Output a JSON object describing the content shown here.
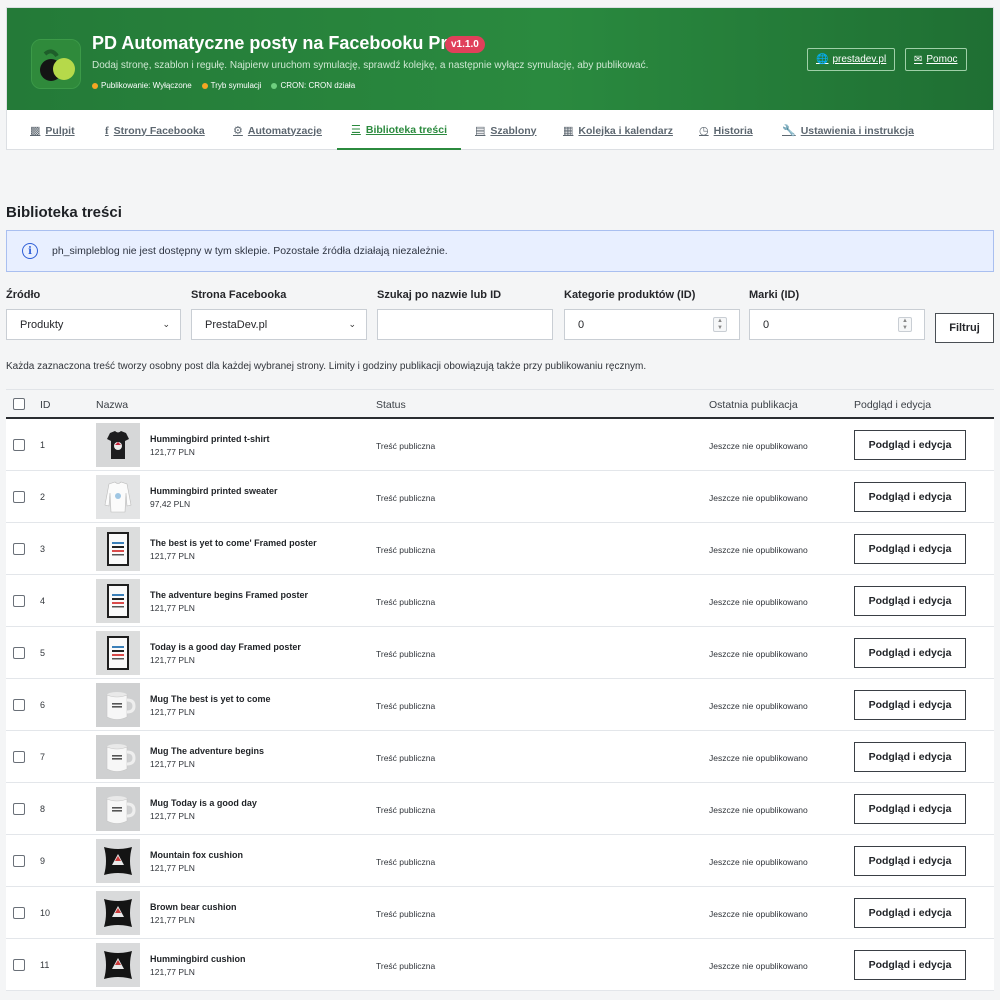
{
  "header": {
    "title": "PD Automatyczne posty na Facebooku Pro",
    "version": "v1.1.0",
    "subtitle": "Dodaj stronę, szablon i regułę. Najpierw uruchom symulację, sprawdź kolejkę, a następnie wyłącz symulację, aby publikować.",
    "statuses": [
      {
        "label": "Publikowanie: Wyłączone",
        "color": "#f5a623"
      },
      {
        "label": "Tryb symulacji",
        "color": "#f5a623"
      },
      {
        "label": "CRON: CRON działa",
        "color": "#6fcf7f"
      }
    ],
    "site_button": "prestadev.pl",
    "help_button": "Pomoc"
  },
  "tabs": [
    {
      "label": "Pulpit",
      "icon": "chart-bar-icon"
    },
    {
      "label": "Strony Facebooka",
      "icon": "facebook-icon"
    },
    {
      "label": "Automatyzacje",
      "icon": "cogs-icon"
    },
    {
      "label": "Biblioteka treści",
      "icon": "list-icon",
      "active": true
    },
    {
      "label": "Szablony",
      "icon": "file-icon"
    },
    {
      "label": "Kolejka i kalendarz",
      "icon": "calendar-icon"
    },
    {
      "label": "Historia",
      "icon": "clock-icon"
    },
    {
      "label": "Ustawienia i instrukcja",
      "icon": "wrench-icon"
    }
  ],
  "page_title": "Biblioteka treści",
  "alert": "ph_simpleblog nie jest dostępny w tym sklepie. Pozostałe źródła działają niezależnie.",
  "filters": {
    "source_label": "Źródło",
    "source_value": "Produkty",
    "page_label": "Strona Facebooka",
    "page_value": "PrestaDev.pl",
    "search_label": "Szukaj po nazwie lub ID",
    "search_value": "",
    "categories_label": "Kategorie produktów (ID)",
    "categories_value": "0",
    "brands_label": "Marki (ID)",
    "brands_value": "0",
    "filter_button": "Filtruj"
  },
  "note": "Każda zaznaczona treść tworzy osobny post dla każdej wybranej strony. Limity i godziny publikacji obowiązują także przy publikowaniu ręcznym.",
  "table": {
    "headers": {
      "id": "ID",
      "name": "Nazwa",
      "status": "Status",
      "last": "Ostatnia publikacja",
      "action": "Podgląd i edycja"
    },
    "rows": [
      {
        "id": "1",
        "name": "Hummingbird printed t-shirt",
        "price": "121,77 PLN",
        "status": "Treść publiczna",
        "last": "Jeszcze nie opublikowano",
        "action": "Podgląd i edycja",
        "thumb": "tshirt"
      },
      {
        "id": "2",
        "name": "Hummingbird printed sweater",
        "price": "97,42 PLN",
        "status": "Treść publiczna",
        "last": "Jeszcze nie opublikowano",
        "action": "Podgląd i edycja",
        "thumb": "sweater"
      },
      {
        "id": "3",
        "name": "The best is yet to come' Framed poster",
        "price": "121,77 PLN",
        "status": "Treść publiczna",
        "last": "Jeszcze nie opublikowano",
        "action": "Podgląd i edycja",
        "thumb": "poster"
      },
      {
        "id": "4",
        "name": "The adventure begins Framed poster",
        "price": "121,77 PLN",
        "status": "Treść publiczna",
        "last": "Jeszcze nie opublikowano",
        "action": "Podgląd i edycja",
        "thumb": "poster"
      },
      {
        "id": "5",
        "name": "Today is a good day Framed poster",
        "price": "121,77 PLN",
        "status": "Treść publiczna",
        "last": "Jeszcze nie opublikowano",
        "action": "Podgląd i edycja",
        "thumb": "poster"
      },
      {
        "id": "6",
        "name": "Mug The best is yet to come",
        "price": "121,77 PLN",
        "status": "Treść publiczna",
        "last": "Jeszcze nie opublikowano",
        "action": "Podgląd i edycja",
        "thumb": "mug"
      },
      {
        "id": "7",
        "name": "Mug The adventure begins",
        "price": "121,77 PLN",
        "status": "Treść publiczna",
        "last": "Jeszcze nie opublikowano",
        "action": "Podgląd i edycja",
        "thumb": "mug"
      },
      {
        "id": "8",
        "name": "Mug Today is a good day",
        "price": "121,77 PLN",
        "status": "Treść publiczna",
        "last": "Jeszcze nie opublikowano",
        "action": "Podgląd i edycja",
        "thumb": "mug"
      },
      {
        "id": "9",
        "name": "Mountain fox cushion",
        "price": "121,77 PLN",
        "status": "Treść publiczna",
        "last": "Jeszcze nie opublikowano",
        "action": "Podgląd i edycja",
        "thumb": "cushion"
      },
      {
        "id": "10",
        "name": "Brown bear cushion",
        "price": "121,77 PLN",
        "status": "Treść publiczna",
        "last": "Jeszcze nie opublikowano",
        "action": "Podgląd i edycja",
        "thumb": "cushion"
      },
      {
        "id": "11",
        "name": "Hummingbird cushion",
        "price": "121,77 PLN",
        "status": "Treść publiczna",
        "last": "Jeszcze nie opublikowano",
        "action": "Podgląd i edycja",
        "thumb": "cushion"
      }
    ]
  }
}
